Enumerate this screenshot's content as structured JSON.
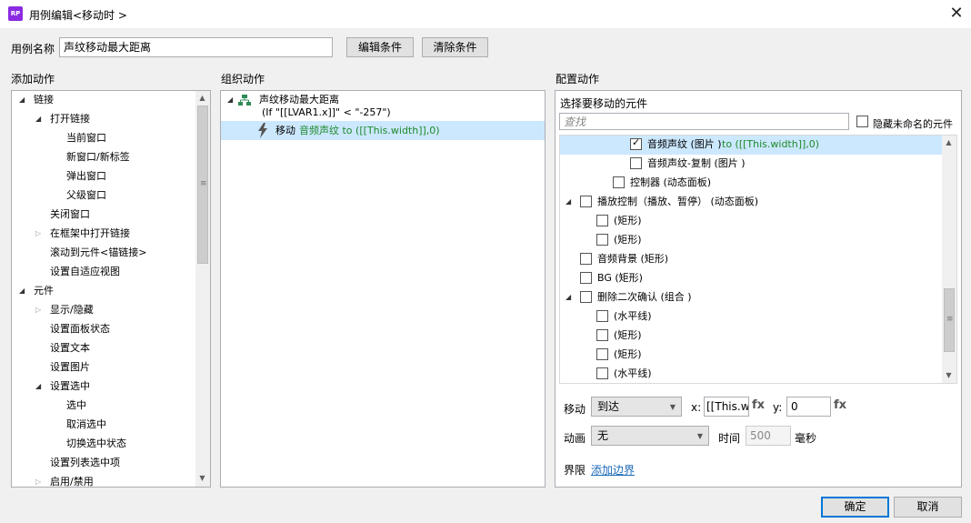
{
  "window": {
    "title": "用例编辑<移动时 >",
    "app_icon_text": "RP",
    "close_glyph": "✕"
  },
  "usecase": {
    "name_label": "用例名称",
    "name_value": "声纹移动最大距离",
    "edit_condition": "编辑条件",
    "clear_condition": "清除条件"
  },
  "sections": {
    "add_action": "添加动作",
    "organize_action": "组织动作",
    "configure_action": "配置动作"
  },
  "add_tree": [
    {
      "label": "链接",
      "level": 0,
      "caret": "open"
    },
    {
      "label": "打开链接",
      "level": 1,
      "caret": "open"
    },
    {
      "label": "当前窗口",
      "level": 2,
      "caret": "none"
    },
    {
      "label": "新窗口/新标签",
      "level": 2,
      "caret": "none"
    },
    {
      "label": "弹出窗口",
      "level": 2,
      "caret": "none"
    },
    {
      "label": "父级窗口",
      "level": 2,
      "caret": "none"
    },
    {
      "label": "关闭窗口",
      "level": 1,
      "caret": "none"
    },
    {
      "label": "在框架中打开链接",
      "level": 1,
      "caret": "closed"
    },
    {
      "label": "滚动到元件<锚链接>",
      "level": 1,
      "caret": "none"
    },
    {
      "label": "设置自适应视图",
      "level": 1,
      "caret": "none"
    },
    {
      "label": "元件",
      "level": 0,
      "caret": "open"
    },
    {
      "label": "显示/隐藏",
      "level": 1,
      "caret": "closed"
    },
    {
      "label": "设置面板状态",
      "level": 1,
      "caret": "none"
    },
    {
      "label": "设置文本",
      "level": 1,
      "caret": "none"
    },
    {
      "label": "设置图片",
      "level": 1,
      "caret": "none"
    },
    {
      "label": "设置选中",
      "level": 1,
      "caret": "open"
    },
    {
      "label": "选中",
      "level": 2,
      "caret": "none"
    },
    {
      "label": "取消选中",
      "level": 2,
      "caret": "none"
    },
    {
      "label": "切换选中状态",
      "level": 2,
      "caret": "none"
    },
    {
      "label": "设置列表选中项",
      "level": 1,
      "caret": "none"
    },
    {
      "label": "启用/禁用",
      "level": 1,
      "caret": "closed"
    }
  ],
  "organize": {
    "case_name": "声纹移动最大距离",
    "case_condition": "(If \"[[LVAR1.x]]\" < \"-257\")",
    "action_verb": "移动",
    "action_detail": "音频声纹 to ([[This.width]],0)"
  },
  "configure": {
    "select_label": "选择要移动的元件",
    "search_placeholder": "查找",
    "hide_unnamed_label": "隐藏未命名的元件",
    "hide_unnamed_checked": false,
    "widgets": [
      {
        "label": "音频声纹 (图片 )",
        "suffix": " to ([[This.width]],0)",
        "level": 3,
        "caret": "none",
        "checked": true,
        "selected": true
      },
      {
        "label": "音频声纹-复制 (图片 )",
        "suffix": "",
        "level": 3,
        "caret": "none",
        "checked": false,
        "selected": false
      },
      {
        "label": "控制器 (动态面板)",
        "suffix": "",
        "level": 2,
        "caret": "none",
        "checked": false,
        "selected": false
      },
      {
        "label": "播放控制（播放、暂停） (动态面板)",
        "suffix": "",
        "level": 0,
        "caret": "open",
        "checked": false,
        "selected": false
      },
      {
        "label": "(矩形)",
        "suffix": "",
        "level": 1,
        "caret": "none",
        "checked": false,
        "selected": false
      },
      {
        "label": "(矩形)",
        "suffix": "",
        "level": 1,
        "caret": "none",
        "checked": false,
        "selected": false
      },
      {
        "label": "音频背景 (矩形)",
        "suffix": "",
        "level": 0,
        "caret": "none",
        "checked": false,
        "selected": false
      },
      {
        "label": "BG (矩形)",
        "suffix": "",
        "level": 0,
        "caret": "none",
        "checked": false,
        "selected": false
      },
      {
        "label": "删除二次确认 (组合 )",
        "suffix": "",
        "level": 0,
        "caret": "open",
        "checked": false,
        "selected": false
      },
      {
        "label": "(水平线)",
        "suffix": "",
        "level": 1,
        "caret": "none",
        "checked": false,
        "selected": false
      },
      {
        "label": "(矩形)",
        "suffix": "",
        "level": 1,
        "caret": "none",
        "checked": false,
        "selected": false
      },
      {
        "label": "(矩形)",
        "suffix": "",
        "level": 1,
        "caret": "none",
        "checked": false,
        "selected": false
      },
      {
        "label": "(水平线)",
        "suffix": "",
        "level": 1,
        "caret": "none",
        "checked": false,
        "selected": false
      }
    ],
    "move_label": "移动",
    "move_type": "到达",
    "x_label": "x:",
    "x_value": "[[This.wi",
    "fx_label": "fx",
    "y_label": "y:",
    "y_value": "0",
    "animation_label": "动画",
    "animation_value": "无",
    "time_label": "时间",
    "time_value": "500",
    "time_unit": "毫秒",
    "bound_label": "界限",
    "add_bound_link": "添加边界"
  },
  "footer": {
    "ok": "确定",
    "cancel": "取消"
  },
  "colors": {
    "selection": "#cce8ff",
    "green_text": "#1f8a2b",
    "link": "#1e6bb8",
    "primary_border": "#0078d7"
  }
}
